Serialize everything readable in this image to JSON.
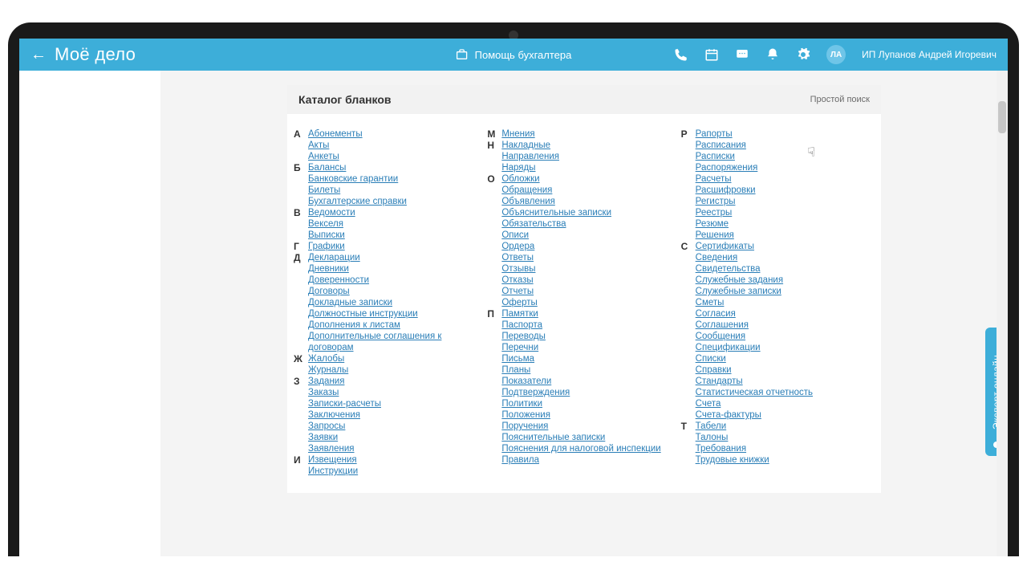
{
  "header": {
    "logo": "Моё дело",
    "help_label": "Помощь бухгалтера",
    "avatar_initials": "ЛА",
    "username": "ИП Лупанов Андрей Игоревич"
  },
  "catalog": {
    "title": "Каталог бланков",
    "search_label": "Простой поиск"
  },
  "expert_tab": "Эксперт онлайн",
  "columns": [
    [
      {
        "letter": "А",
        "items": [
          "Абонементы",
          "Акты",
          "Анкеты"
        ]
      },
      {
        "letter": "Б",
        "items": [
          "Балансы",
          "Банковские гарантии",
          "Билеты",
          "Бухгалтерские справки"
        ]
      },
      {
        "letter": "В",
        "items": [
          "Ведомости",
          "Векселя",
          "Выписки"
        ]
      },
      {
        "letter": "Г",
        "items": [
          "Графики"
        ]
      },
      {
        "letter": "Д",
        "items": [
          "Декларации",
          "Дневники",
          "Доверенности",
          "Договоры",
          "Докладные записки",
          "Должностные инструкции",
          "Дополнения к листам",
          "Дополнительные соглашения к договорам"
        ]
      },
      {
        "letter": "Ж",
        "items": [
          "Жалобы",
          "Журналы"
        ]
      },
      {
        "letter": "З",
        "items": [
          "Задания",
          "Заказы",
          "Записки-расчеты",
          "Заключения",
          "Запросы",
          "Заявки",
          "Заявления"
        ]
      },
      {
        "letter": "И",
        "items": [
          "Извещения",
          "Инструкции"
        ]
      }
    ],
    [
      {
        "letter": "М",
        "items": [
          "Мнения"
        ]
      },
      {
        "letter": "Н",
        "items": [
          "Накладные",
          "Направления",
          "Наряды"
        ]
      },
      {
        "letter": "О",
        "items": [
          "Обложки",
          "Обращения",
          "Объявления",
          "Объяснительные записки",
          "Обязательства",
          "Описи",
          "Ордера",
          "Ответы",
          "Отзывы",
          "Отказы",
          "Отчеты",
          "Оферты"
        ]
      },
      {
        "letter": "П",
        "items": [
          "Памятки",
          "Паспорта",
          "Переводы",
          "Перечни",
          "Письма",
          "Планы",
          "Показатели",
          "Подтверждения",
          "Политики",
          "Положения",
          "Поручения",
          "Пояснительные записки",
          "Пояснения для налоговой инспекции",
          "Правила"
        ]
      }
    ],
    [
      {
        "letter": "Р",
        "items": [
          "Рапорты",
          "Расписания",
          "Расписки",
          "Распоряжения",
          "Расчеты",
          "Расшифровки",
          "Регистры",
          "Реестры",
          "Резюме",
          "Решения"
        ]
      },
      {
        "letter": "С",
        "items": [
          "Сертификаты",
          "Сведения",
          "Свидетельства",
          "Служебные задания",
          "Служебные записки",
          "Сметы",
          "Согласия",
          "Соглашения",
          "Сообщения",
          "Спецификации",
          "Списки",
          "Справки",
          "Стандарты",
          "Статистическая отчетность",
          "Счета",
          "Счета-фактуры"
        ]
      },
      {
        "letter": "Т",
        "items": [
          "Табели",
          "Талоны",
          "Требования",
          "Трудовые книжки"
        ]
      }
    ]
  ]
}
